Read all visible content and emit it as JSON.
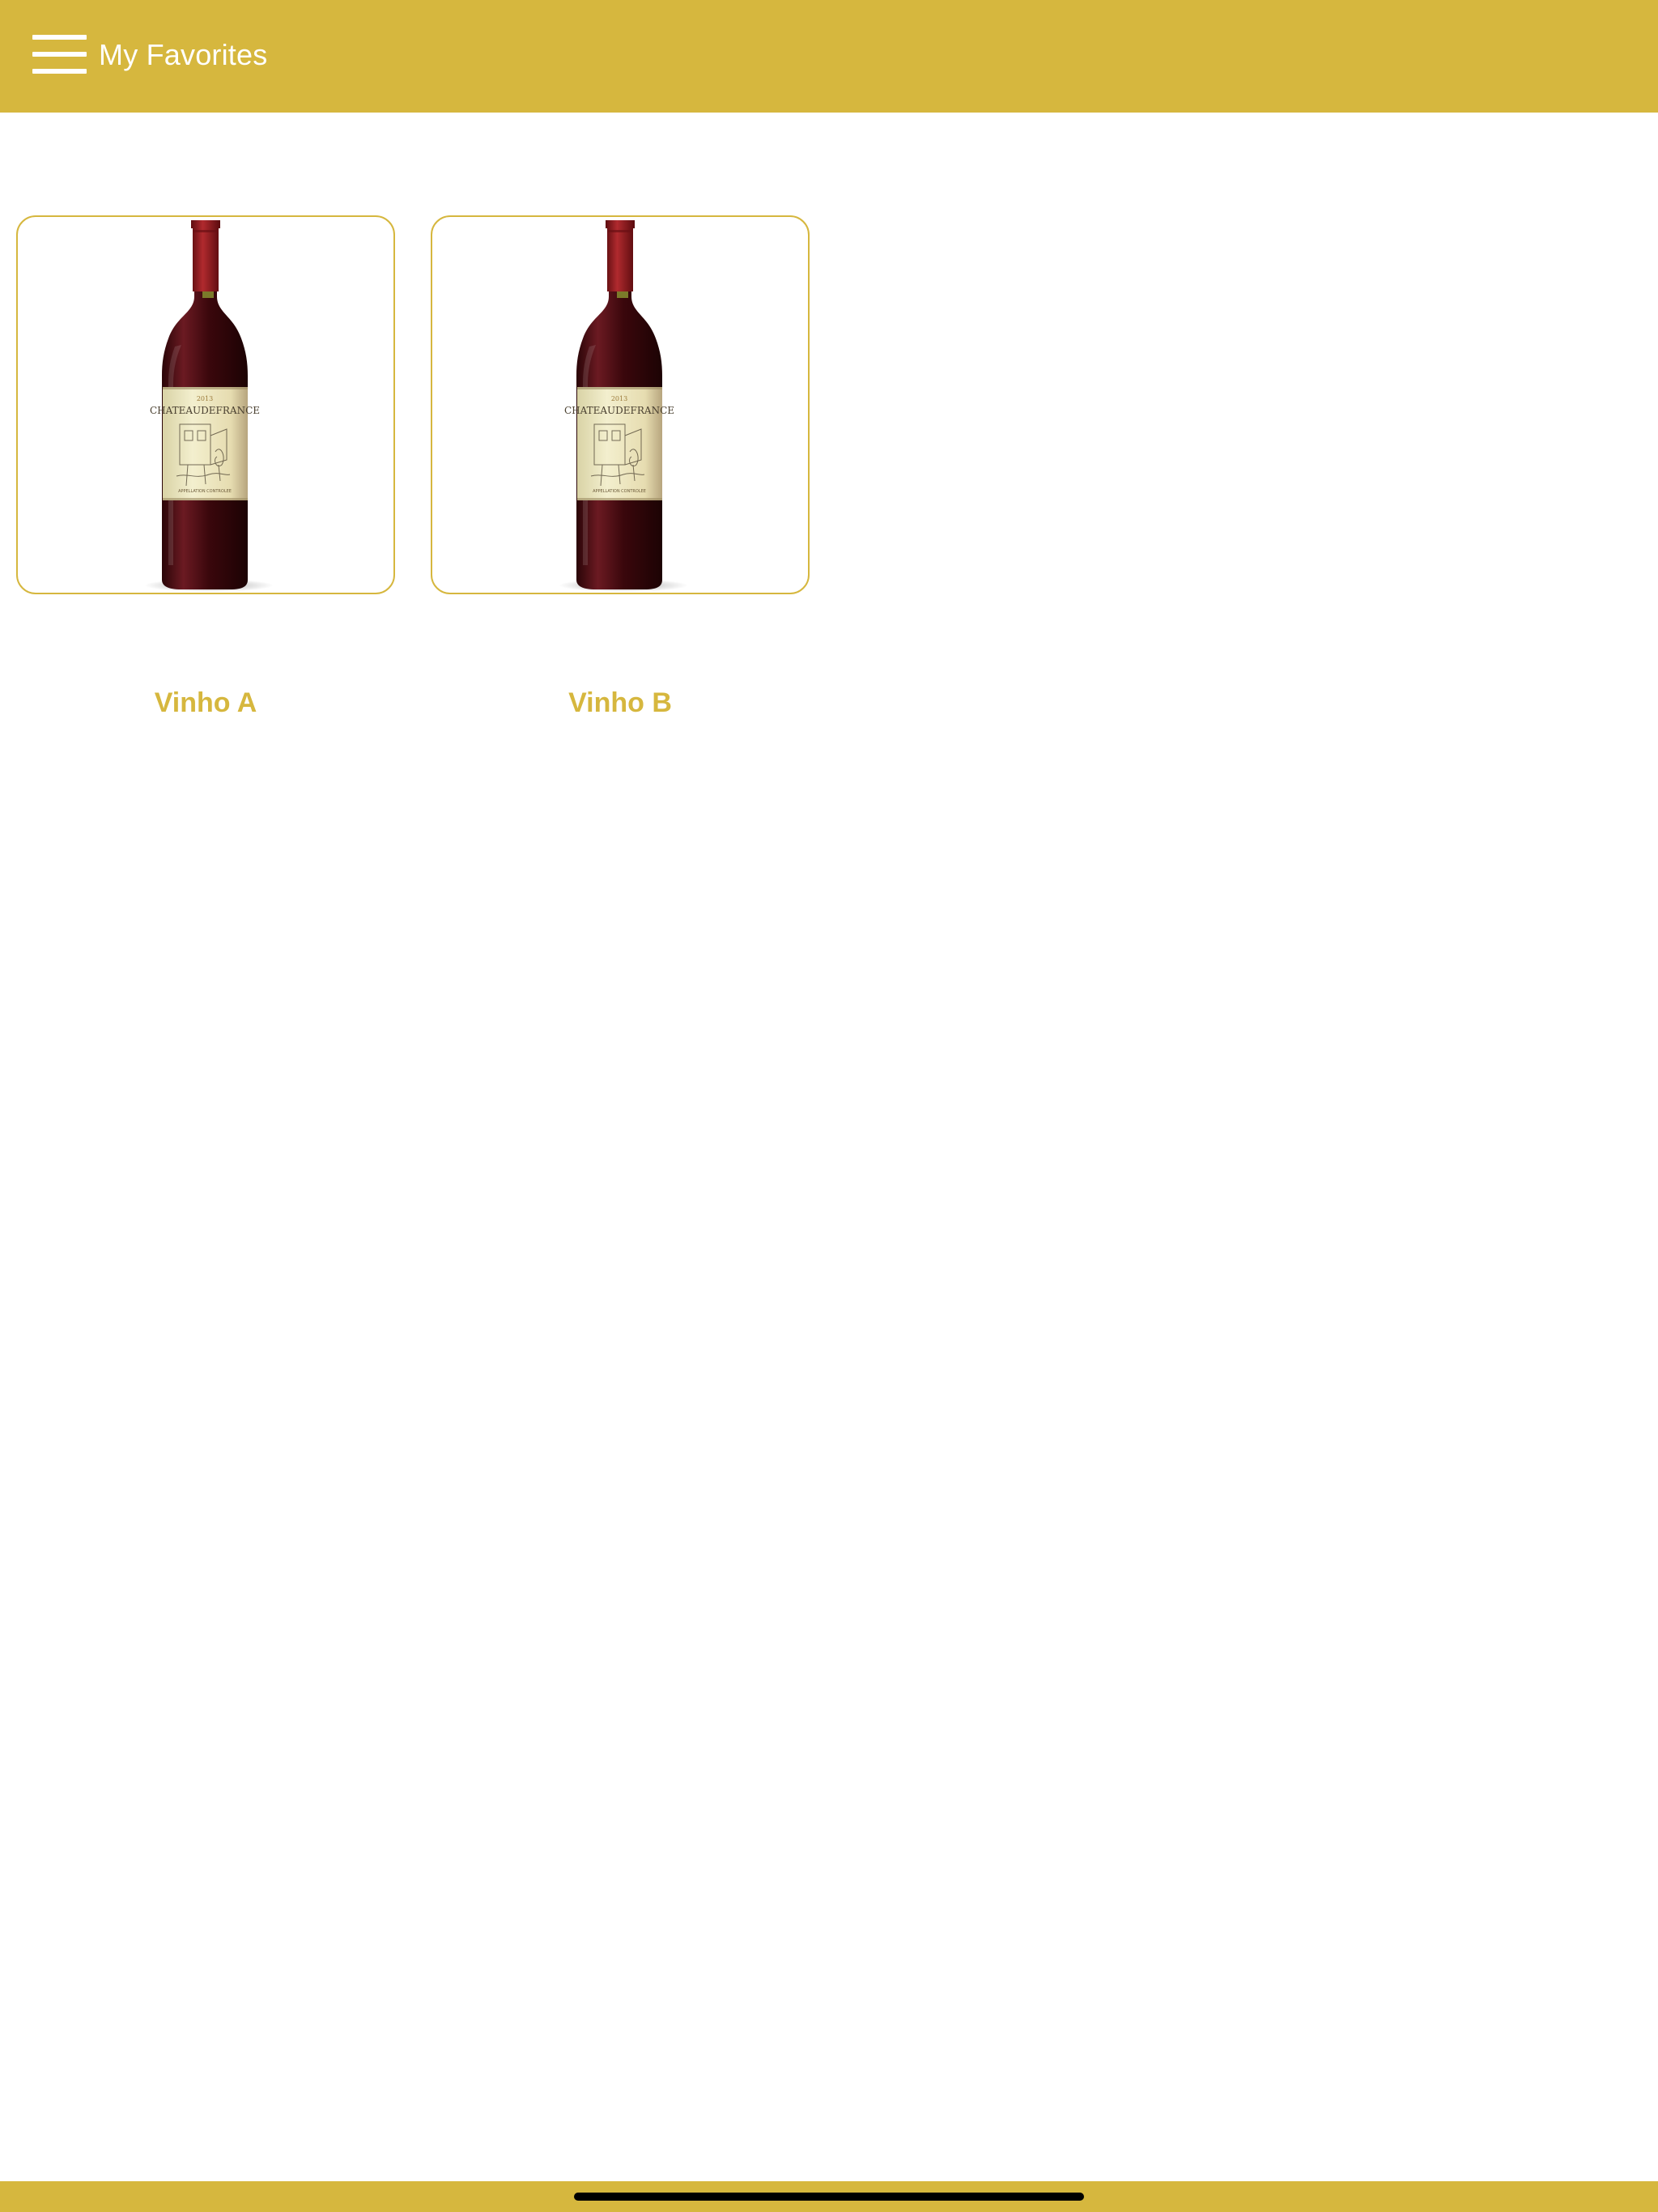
{
  "header": {
    "title": "My Favorites",
    "menu_icon": "hamburger-menu-icon",
    "background_color": "#D6B73E"
  },
  "favorites": [
    {
      "name": "Vinho A",
      "image": "red-wine-bottle",
      "label_brand": "CHATEAUDEFRANCE"
    },
    {
      "name": "Vinho B",
      "image": "red-wine-bottle",
      "label_brand": "CHATEAUDEFRANCE"
    }
  ],
  "colors": {
    "accent": "#D6B73E",
    "bottle": "#4A0C12",
    "capsule": "#8E1A1E",
    "wine_label": "#EFEBC8"
  }
}
